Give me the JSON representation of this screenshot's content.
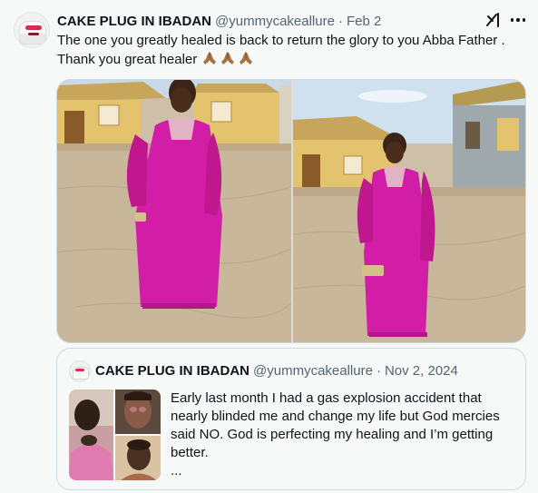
{
  "tweet": {
    "author_name": "CAKE PLUG IN IBADAN",
    "author_handle": "@yummycakeallure",
    "separator": "·",
    "date": "Feb 2",
    "text_lines": [
      "The one you greatly healed is back to return the glory to you Abba Father .",
      "Thank you great healer"
    ],
    "emojis": [
      "folded-hands",
      "folded-hands",
      "folded-hands"
    ],
    "icons": {
      "grok": "grok-icon",
      "more": "more-icon"
    }
  },
  "media": {
    "photos": [
      "photo-left",
      "photo-right"
    ]
  },
  "quoted": {
    "author_name": "CAKE PLUG IN IBADAN",
    "author_handle": "@yummycakeallure",
    "separator": "·",
    "date": "Nov 2, 2024",
    "text_lines": [
      "Early last month I had a gas explosion accident that",
      "nearly blinded me and change my life but God mercies",
      "said NO.  God is perfecting my healing and I’m getting",
      "better.",
      "..."
    ]
  },
  "colors": {
    "text": "#0f1419",
    "muted": "#536471",
    "border": "#cfd9de",
    "background": "#f7f9f9",
    "dress": "#d21ea6"
  }
}
